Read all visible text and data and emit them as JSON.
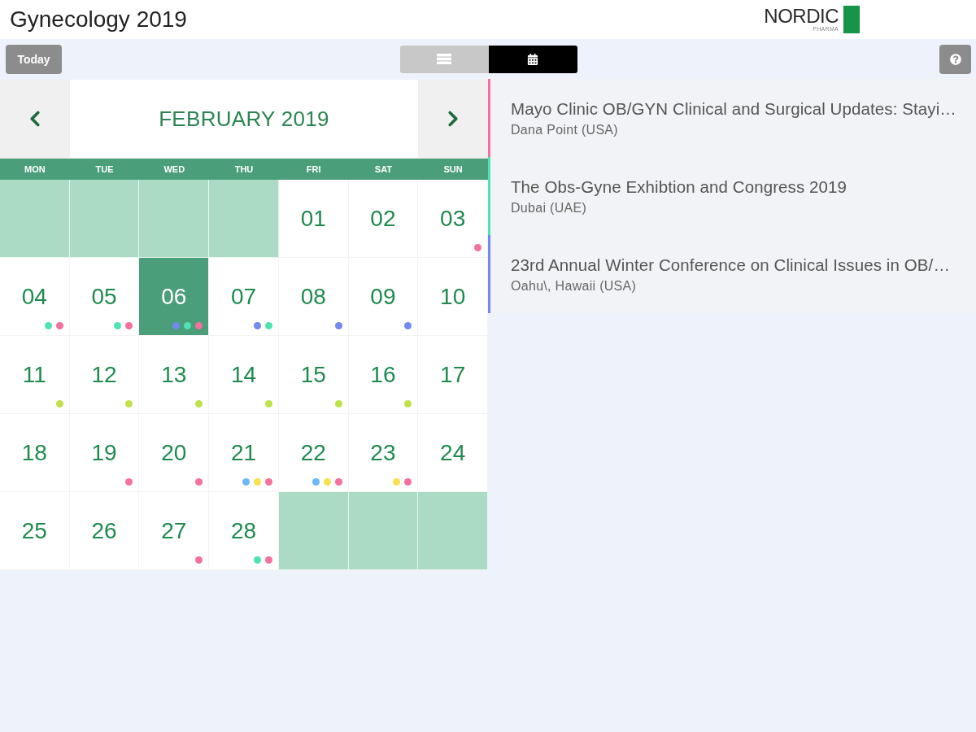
{
  "header": {
    "title": "Gynecology 2019",
    "logo": {
      "name": "NORDIC",
      "tagline": "PHARMA"
    }
  },
  "toolbar": {
    "today_button": "Today",
    "view_toggle": [
      {
        "kind": "list",
        "selected": false
      },
      {
        "kind": "calendar",
        "selected": true
      }
    ]
  },
  "calendar": {
    "month": "FEBRUARY 2019",
    "weekdays": [
      "MON",
      "TUE",
      "WED",
      "THU",
      "FRI",
      "SAT",
      "SUN"
    ],
    "days": [
      {
        "kind": "blank"
      },
      {
        "kind": "blank"
      },
      {
        "kind": "blank"
      },
      {
        "kind": "blank"
      },
      {
        "kind": "day",
        "label": "01",
        "selected": false
      },
      {
        "kind": "day",
        "label": "02",
        "selected": false
      },
      {
        "kind": "day",
        "label": "03",
        "selected": false,
        "dots": [
          {
            "color": "#f5709c"
          }
        ]
      },
      {
        "kind": "day",
        "label": "04",
        "selected": false,
        "dots": [
          {
            "color": "#4fe3b2"
          },
          {
            "color": "#f5709c"
          }
        ]
      },
      {
        "kind": "day",
        "label": "05",
        "selected": false,
        "dots": [
          {
            "color": "#4fe3b2"
          },
          {
            "color": "#f5709c"
          }
        ]
      },
      {
        "kind": "day",
        "label": "06",
        "selected": true,
        "dots": [
          {
            "color": "#7289f0"
          },
          {
            "color": "#4fe3b2"
          },
          {
            "color": "#f5709c"
          }
        ]
      },
      {
        "kind": "day",
        "label": "07",
        "selected": false,
        "dots": [
          {
            "color": "#7289f0"
          },
          {
            "color": "#4fe3b2"
          }
        ]
      },
      {
        "kind": "day",
        "label": "08",
        "selected": false,
        "dots": [
          {
            "color": "#7289f0"
          }
        ]
      },
      {
        "kind": "day",
        "label": "09",
        "selected": false,
        "dots": [
          {
            "color": "#7289f0"
          }
        ]
      },
      {
        "kind": "day",
        "label": "10",
        "selected": false
      },
      {
        "kind": "day",
        "label": "11",
        "selected": false,
        "dots": [
          {
            "color": "#bfe24a"
          }
        ]
      },
      {
        "kind": "day",
        "label": "12",
        "selected": false,
        "dots": [
          {
            "color": "#bfe24a"
          }
        ]
      },
      {
        "kind": "day",
        "label": "13",
        "selected": false,
        "dots": [
          {
            "color": "#bfe24a"
          }
        ]
      },
      {
        "kind": "day",
        "label": "14",
        "selected": false,
        "dots": [
          {
            "color": "#bfe24a"
          }
        ]
      },
      {
        "kind": "day",
        "label": "15",
        "selected": false,
        "dots": [
          {
            "color": "#bfe24a"
          }
        ]
      },
      {
        "kind": "day",
        "label": "16",
        "selected": false,
        "dots": [
          {
            "color": "#bfe24a"
          }
        ]
      },
      {
        "kind": "day",
        "label": "17",
        "selected": false
      },
      {
        "kind": "day",
        "label": "18",
        "selected": false
      },
      {
        "kind": "day",
        "label": "19",
        "selected": false,
        "dots": [
          {
            "color": "#f5709c"
          }
        ]
      },
      {
        "kind": "day",
        "label": "20",
        "selected": false,
        "dots": [
          {
            "color": "#f5709c"
          }
        ]
      },
      {
        "kind": "day",
        "label": "21",
        "selected": false,
        "dots": [
          {
            "color": "#6db8f8"
          },
          {
            "color": "#f8e050"
          },
          {
            "color": "#f5709c"
          }
        ]
      },
      {
        "kind": "day",
        "label": "22",
        "selected": false,
        "dots": [
          {
            "color": "#6db8f8"
          },
          {
            "color": "#f8e050"
          },
          {
            "color": "#f5709c"
          }
        ]
      },
      {
        "kind": "day",
        "label": "23",
        "selected": false,
        "dots": [
          {
            "color": "#f8e050"
          },
          {
            "color": "#f5709c"
          }
        ]
      },
      {
        "kind": "day",
        "label": "24",
        "selected": false
      },
      {
        "kind": "day",
        "label": "25",
        "selected": false
      },
      {
        "kind": "day",
        "label": "26",
        "selected": false
      },
      {
        "kind": "day",
        "label": "27",
        "selected": false,
        "dots": [
          {
            "color": "#f5709c"
          }
        ]
      },
      {
        "kind": "day",
        "label": "28",
        "selected": false,
        "dots": [
          {
            "color": "#4fe3b2"
          },
          {
            "color": "#f5709c"
          }
        ]
      },
      {
        "kind": "blank"
      },
      {
        "kind": "blank"
      },
      {
        "kind": "blank"
      }
    ]
  },
  "events": [
    {
      "title": "Mayo Clinic OB/GYN Clinical and Surgical Updates: Stayi…",
      "location": "Dana Point (USA)",
      "color": "#f5709c"
    },
    {
      "title": "The Obs-Gyne Exhibtion and Congress 2019",
      "location": "Dubai (UAE)",
      "color": "#4fe3b2"
    },
    {
      "title": "23rd Annual Winter Conference on Clinical Issues in OB/…",
      "location": "Oahu\\, Hawaii (USA)",
      "color": "#7289f0"
    }
  ]
}
